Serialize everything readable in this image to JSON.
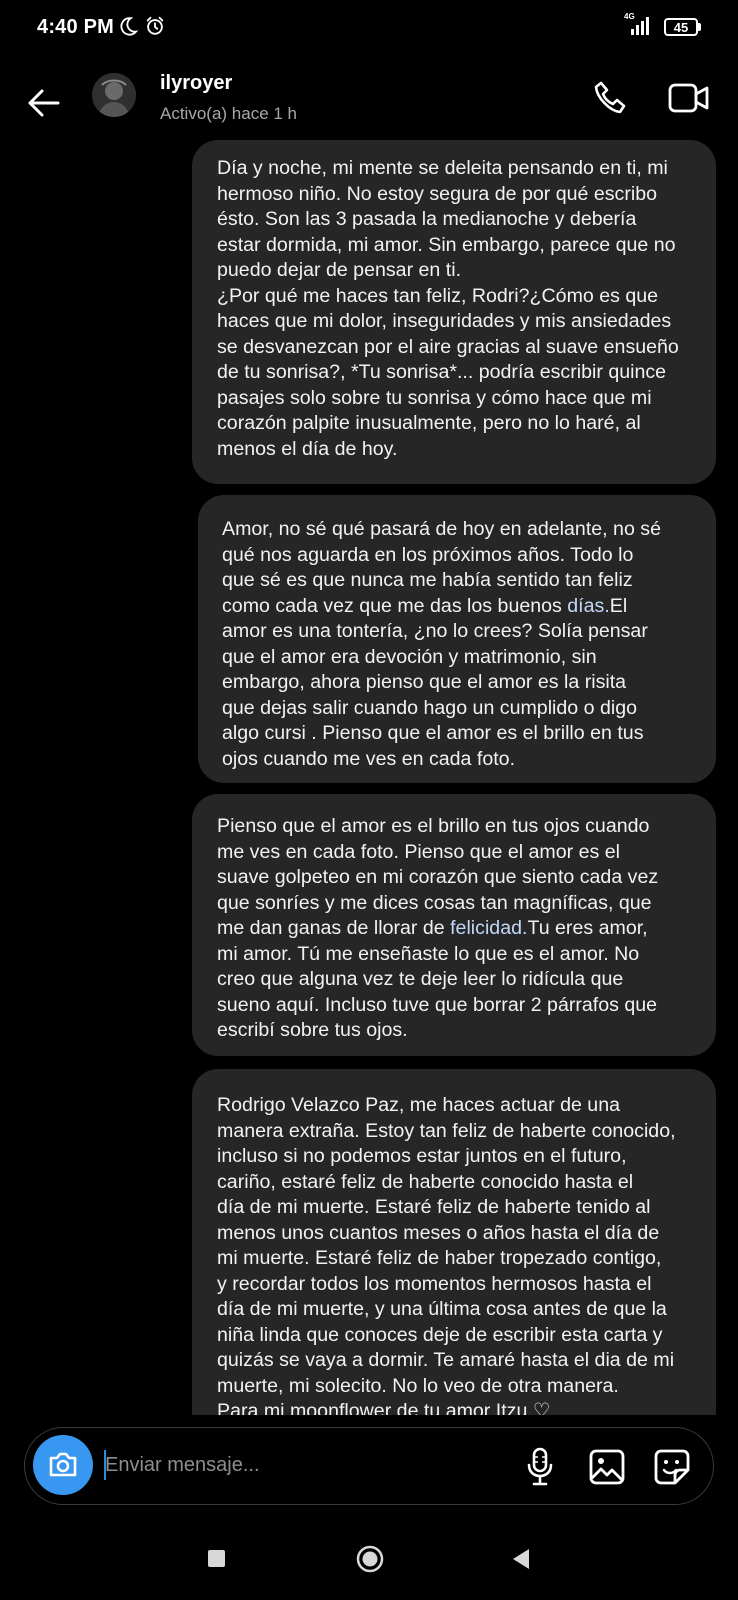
{
  "status_bar": {
    "time": "4:40 PM",
    "network": "4G",
    "battery": "45",
    "icons": [
      "moon-icon",
      "alarm-icon",
      "signal-icon",
      "battery-icon"
    ]
  },
  "header": {
    "username": "ilyroyer",
    "presence": "Activo(a) hace 1 h",
    "icons": [
      "back-arrow-icon",
      "phone-icon",
      "video-call-icon"
    ]
  },
  "messages": [
    {
      "text": "Día y noche, mi mente se deleita pensando en ti, mi\nhermoso niño. No estoy segura de por qué escribo\nésto. Son las 3 pasada la medianoche y debería\nestar dormida, mi amor. Sin embargo, parece que no\npuedo dejar de pensar en ti.\n¿Por qué me haces tan feliz, Rodri?¿Cómo es que\nhaces que mi dolor, inseguridades y mis ansiedades\nse desvanezcan por el aire gracias al suave ensueño\nde tu sonrisa?, *Tu sonrisa*... podría escribir quince\npasajes solo sobre tu sonrisa y cómo hace que mi\ncorazón palpite inusualmente, pero no lo haré, al\nmenos el día de hoy."
    },
    {
      "text_before": "Amor, no sé qué pasará de hoy en adelante, no sé\nqué nos aguarda en los próximos años. Todo lo\nque sé es que nunca me había sentido tan feliz\ncomo cada vez que me das los buenos ",
      "link": "días.",
      "text_after": "El\namor es una tontería, ¿no lo crees? Solía pensar\nque el amor era devoción y matrimonio, sin\nembargo, ahora pienso que el amor es la risita\nque dejas salir cuando hago un cumplido o digo\nalgo cursi . Pienso que el amor es el brillo en tus\nojos cuando me ves en cada foto."
    },
    {
      "text_before": "Pienso que el amor es el brillo en tus ojos cuando\nme ves en cada foto. Pienso que el amor es el\nsuave golpeteo en mi corazón que siento cada vez\nque sonríes y me dices cosas tan magníficas, que\nme dan ganas de llorar de ",
      "link": "felicidad.",
      "text_after": "Tu eres amor,\nmi amor. Tú me enseñaste lo que es el amor. No\ncreo que alguna vez te deje leer lo ridícula que\nsueno aquí. Incluso tuve que borrar 2 párrafos que\nescribí sobre tus ojos."
    },
    {
      "text": "Rodrigo Velazco Paz, me haces actuar de una\nmanera extraña. Estoy tan feliz de haberte conocido,\nincluso si no podemos estar juntos en el futuro,\ncariño, estaré feliz de haberte conocido hasta el\ndía de mi muerte. Estaré feliz de haberte tenido al\nmenos unos cuantos meses o años hasta el día de\nmi muerte. Estaré feliz de haber tropezado contigo,\ny recordar todos los momentos hermosos hasta el\ndía de mi muerte, y una última cosa antes de que la\nniña linda que conoces deje de escribir esta carta y\nquizás se vaya a dormir. Te amaré hasta el dia de mi\nmuerte, mi solecito. No lo veo de otra manera.\nPara mi moonflower de tu amor                    Itzu ♡"
    }
  ],
  "composer": {
    "placeholder": "Enviar mensaje...",
    "icons": [
      "camera-icon",
      "microphone-icon",
      "gallery-icon",
      "sticker-icon"
    ]
  },
  "nav_bar": {
    "icons": [
      "recent-apps-icon",
      "home-icon",
      "back-icon"
    ]
  },
  "colors": {
    "background": "#000000",
    "bubble": "#262626",
    "camera_button": "#3897f0",
    "link_text": "#c3d7f7"
  }
}
